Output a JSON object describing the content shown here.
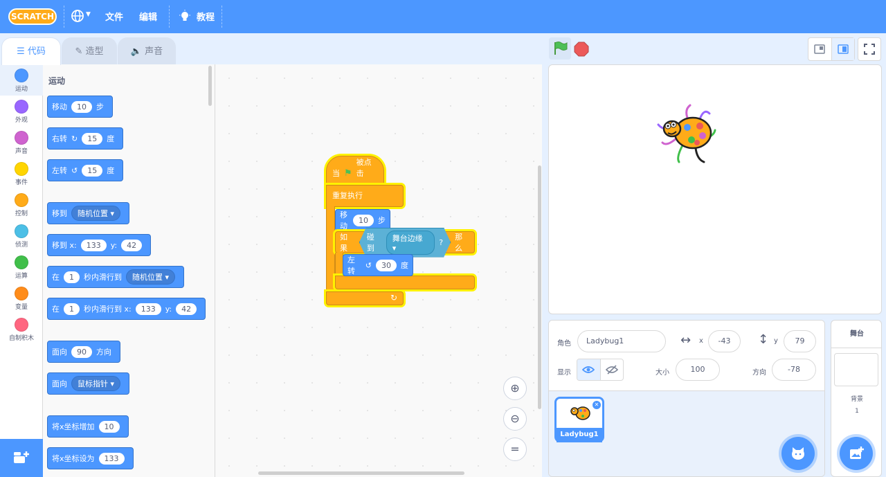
{
  "menu": {
    "logo": "SCRATCH",
    "language_icon": "globe-icon",
    "file": "文件",
    "edit": "编辑",
    "tutorials": "教程"
  },
  "tabs": [
    {
      "label": "代码",
      "icon": "code-icon"
    },
    {
      "label": "造型",
      "icon": "brush-icon"
    },
    {
      "label": "声音",
      "icon": "speaker-icon"
    }
  ],
  "categories": [
    {
      "label": "运动",
      "color": "#4c97ff"
    },
    {
      "label": "外观",
      "color": "#9966ff"
    },
    {
      "label": "声音",
      "color": "#cf63cf"
    },
    {
      "label": "事件",
      "color": "#ffd500"
    },
    {
      "label": "控制",
      "color": "#ffab19"
    },
    {
      "label": "侦测",
      "color": "#4cbfe6"
    },
    {
      "label": "运算",
      "color": "#40bf4a"
    },
    {
      "label": "变量",
      "color": "#ff8c1a"
    },
    {
      "label": "自制积木",
      "color": "#ff6680"
    }
  ],
  "palette": {
    "section": "运动",
    "move": {
      "a": "移动",
      "n": "10",
      "b": "步"
    },
    "turn_right": {
      "a": "右转",
      "n": "15",
      "b": "度"
    },
    "turn_left": {
      "a": "左转",
      "n": "15",
      "b": "度"
    },
    "goto": {
      "a": "移到",
      "dd": "随机位置"
    },
    "goto_xy": {
      "a": "移到 x:",
      "x": "133",
      "yl": "y:",
      "y": "42"
    },
    "glide": {
      "a": "在",
      "n": "1",
      "b": "秒内滑行到",
      "dd": "随机位置"
    },
    "glide_xy": {
      "a": "在",
      "n": "1",
      "b": "秒内滑行到 x:",
      "x": "133",
      "yl": "y:",
      "y": "42"
    },
    "point": {
      "a": "面向",
      "n": "90",
      "b": "方向"
    },
    "point_towards": {
      "a": "面向",
      "dd": "鼠标指针"
    },
    "change_x": {
      "a": "将x坐标增加",
      "n": "10"
    },
    "set_x": {
      "a": "将x坐标设为",
      "n": "133"
    }
  },
  "script": {
    "hat_a": "当",
    "hat_b": "被点击",
    "forever": "重复执行",
    "move_a": "移动",
    "move_n": "10",
    "move_b": "步",
    "if_a": "如果",
    "touch_a": "碰到",
    "touch_dd": "舞台边缘",
    "touch_q": "?",
    "if_b": "那么",
    "turn_a": "左转",
    "turn_n": "30",
    "turn_b": "度"
  },
  "sprite_info": {
    "sprite_label": "角色",
    "sprite_name": "Ladybug1",
    "x_label": "x",
    "x_value": "-43",
    "y_label": "y",
    "y_value": "79",
    "show_label": "显示",
    "size_label": "大小",
    "size_value": "100",
    "direction_label": "方向",
    "direction_value": "-78"
  },
  "sprites": [
    {
      "name": "Ladybug1",
      "selected": true
    }
  ],
  "stage_pane": {
    "title": "舞台",
    "backdrop_label": "背景",
    "backdrop_count": "1"
  }
}
